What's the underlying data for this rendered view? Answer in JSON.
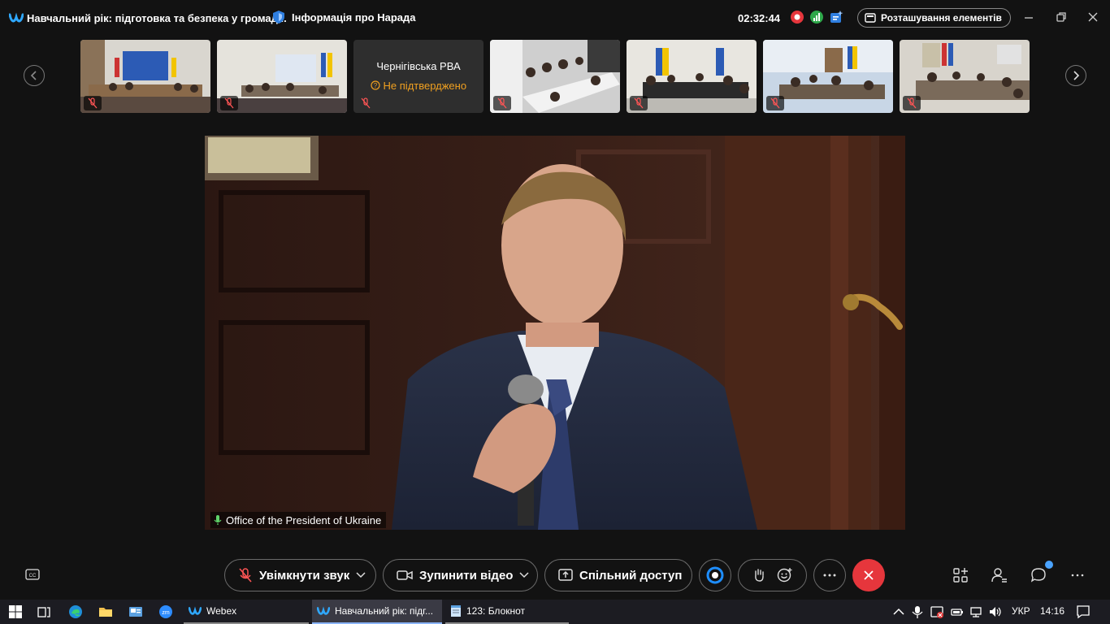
{
  "window": {
    "meeting_title": "Навчальний рік: підготовка та безпека у громад...",
    "info_label": "Інформація про Нарада",
    "timer": "02:32:44",
    "layout_label": "Розташування елементів"
  },
  "participants": [
    {
      "type": "video",
      "muted": true
    },
    {
      "type": "video",
      "muted": true
    },
    {
      "type": "placeholder",
      "name": "Чернігівська РВА",
      "status": "Не підтверджено",
      "muted": true
    },
    {
      "type": "video",
      "muted": true
    },
    {
      "type": "video",
      "muted": true
    },
    {
      "type": "video",
      "muted": true
    },
    {
      "type": "video",
      "muted": true
    }
  ],
  "stage": {
    "speaker_name": "Office of the President of Ukraine"
  },
  "controls": {
    "unmute_label": "Увімкнути звук",
    "stop_video_label": "Зупинити відео",
    "share_label": "Спільний доступ"
  },
  "taskbar": {
    "apps": [
      {
        "label": "Webex"
      },
      {
        "label": "Навчальний рік: підг..."
      },
      {
        "label": "123: Блокнот"
      }
    ],
    "language": "УКР",
    "clock": "14:16"
  },
  "colors": {
    "end_call": "#e6363c",
    "warning": "#f0a020",
    "accent": "#1e8eff"
  }
}
